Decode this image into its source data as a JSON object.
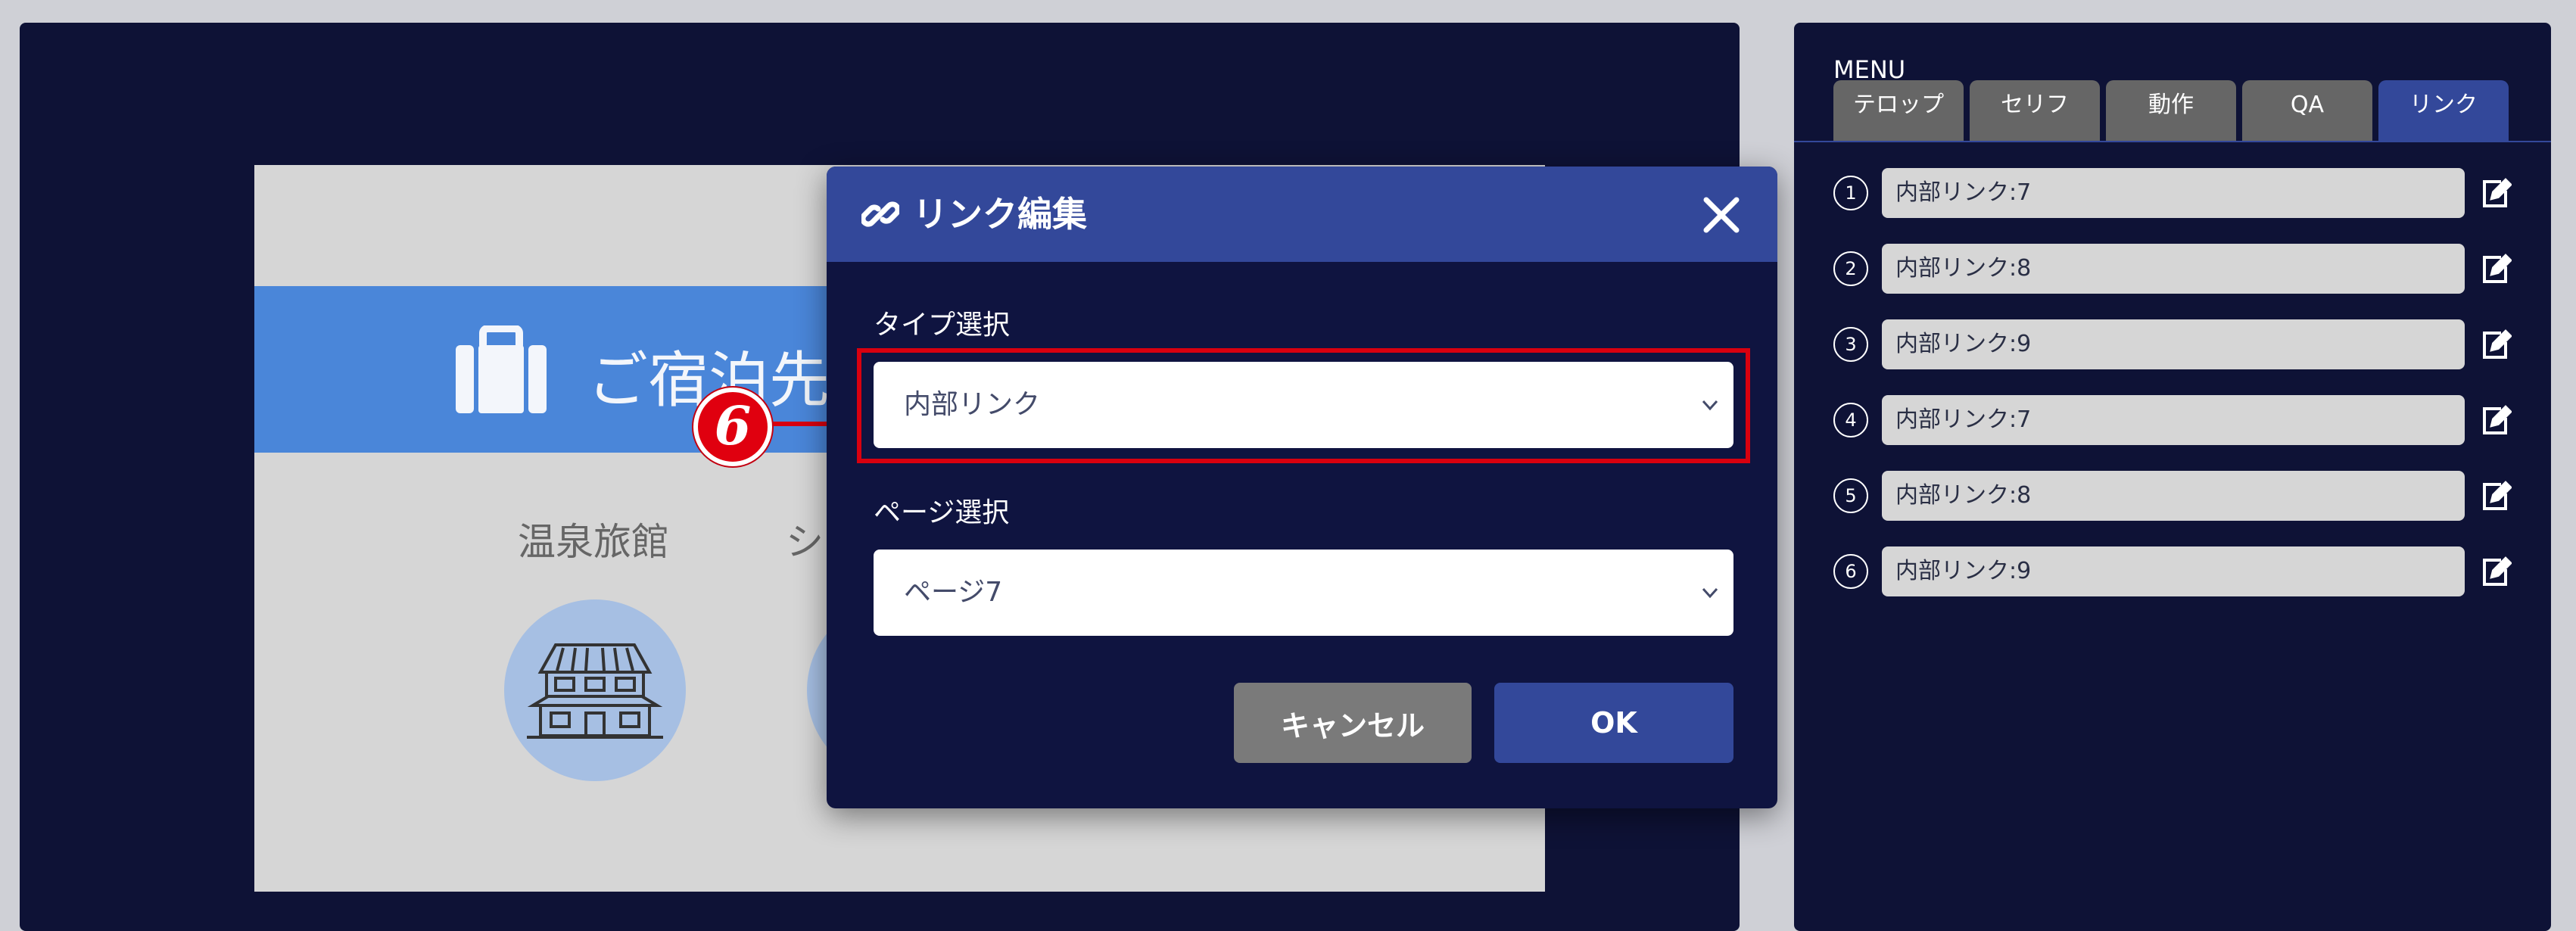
{
  "slide": {
    "banner_title": "ご宿泊先は",
    "categories": [
      {
        "label": "温泉旅館"
      },
      {
        "label": "シテ"
      }
    ]
  },
  "callout": {
    "number": "6"
  },
  "dialog": {
    "title": "リンク編集",
    "type_label": "タイプ選択",
    "type_value": "内部リンク",
    "page_label": "ページ選択",
    "page_value": "ページ7",
    "cancel_label": "キャンセル",
    "ok_label": "OK"
  },
  "panel": {
    "menu_title": "MENU",
    "tabs": [
      {
        "label": "テロップ",
        "active": false
      },
      {
        "label": "セリフ",
        "active": false
      },
      {
        "label": "動作",
        "active": false
      },
      {
        "label": "QA",
        "active": false
      },
      {
        "label": "リンク",
        "active": true
      }
    ],
    "links": [
      {
        "num": "1",
        "label": "内部リンク:7"
      },
      {
        "num": "2",
        "label": "内部リンク:8"
      },
      {
        "num": "3",
        "label": "内部リンク:9"
      },
      {
        "num": "4",
        "label": "内部リンク:7"
      },
      {
        "num": "5",
        "label": "内部リンク:8"
      },
      {
        "num": "6",
        "label": "内部リンク:9"
      }
    ]
  },
  "colors": {
    "background": "#0e1236",
    "accent": "#33489a",
    "banner": "#4a86d9",
    "highlight": "#d8000f"
  },
  "icons": [
    "suitcase-icon",
    "inn-icon",
    "link-icon",
    "close-icon",
    "chevron-down-icon",
    "edit-icon"
  ]
}
